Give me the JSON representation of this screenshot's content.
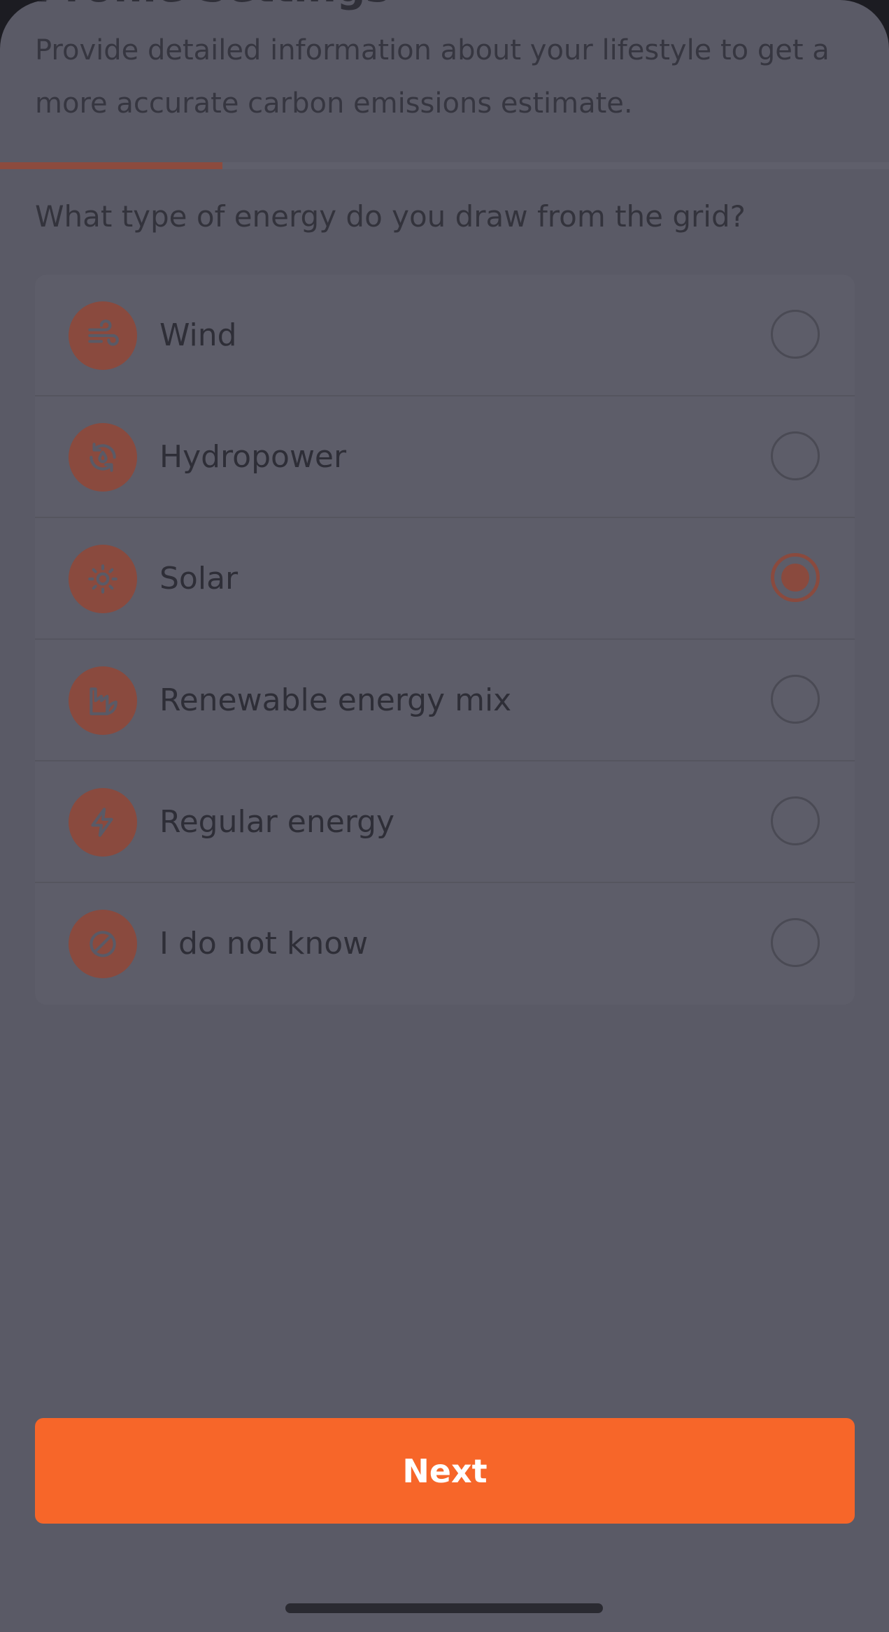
{
  "page": {
    "title": "Profile Settings",
    "subtitle": "Provide detailed information about your lifestyle to get a more accurate carbon emissions estimate."
  },
  "progress": {
    "fraction": 0.25
  },
  "question": "What type of energy do you draw from the grid?",
  "options": [
    {
      "label": "Wind",
      "icon": "wind-icon",
      "selected": false
    },
    {
      "label": "Hydropower",
      "icon": "hydropower-icon",
      "selected": false
    },
    {
      "label": "Solar",
      "icon": "sun-icon",
      "selected": true
    },
    {
      "label": "Renewable energy mix",
      "icon": "factory-leaf-icon",
      "selected": false
    },
    {
      "label": "Regular energy",
      "icon": "lightning-icon",
      "selected": false
    },
    {
      "label": "I do not know",
      "icon": "prohibited-icon",
      "selected": false
    }
  ],
  "next_button": {
    "label": "Next"
  },
  "colors": {
    "accent": "#f76629",
    "accent_dimmed": "#8a4a3e",
    "overlay": "#5a5a66"
  }
}
